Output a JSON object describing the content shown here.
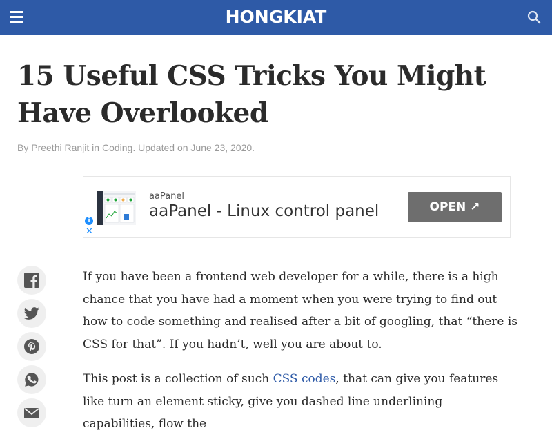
{
  "header": {
    "logo": "HONGKIAT",
    "menu_icon": "hamburger-menu-icon",
    "search_icon": "search-icon",
    "background": "#2e5aa7"
  },
  "article": {
    "title": "15 Useful CSS Tricks You Might Have Overlooked",
    "meta": {
      "by": "By ",
      "author": "Preethi Ranjit",
      "in": " in ",
      "category": "Coding",
      "updated": ". Updated on June 23, 2020."
    }
  },
  "ad": {
    "source": "aaPanel",
    "headline": "aaPanel - Linux control panel",
    "button_label": "OPEN ↗",
    "info_icon": "info-icon",
    "close_icon": "close-icon"
  },
  "share": [
    {
      "name": "facebook-icon"
    },
    {
      "name": "twitter-icon"
    },
    {
      "name": "pinterest-icon"
    },
    {
      "name": "whatsapp-icon"
    },
    {
      "name": "email-icon"
    }
  ],
  "body": {
    "p1": "If you have been a frontend web developer for a while, there is a high chance that you have had a moment when you were trying to find out how to code something and realised after a bit of googling, that “there is CSS for that”. If you hadn’t, well you are about to.",
    "p2_before": "This post is a collection of such ",
    "p2_link": "CSS codes",
    "p2_after": ", that can give you features like turn an element sticky, give you dashed line underlining capabilities, flow the"
  }
}
